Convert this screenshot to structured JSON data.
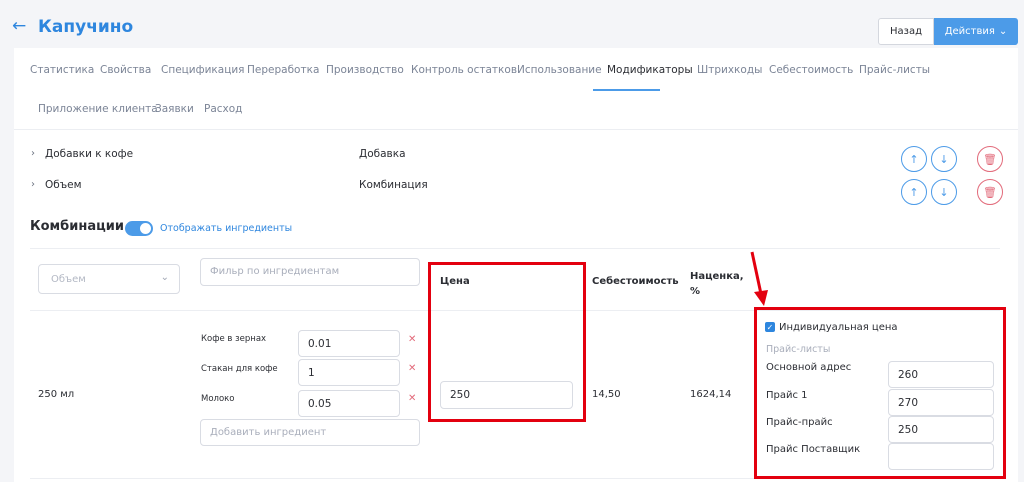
{
  "header": {
    "title": "Капучино",
    "back_button": "Назад",
    "actions_button": "Действия"
  },
  "tabs": [
    "Статистика",
    "Свойства",
    "Спецификация",
    "Переработка",
    "Производство",
    "Контроль остатков",
    "Использование",
    "Модификаторы",
    "Штрихкоды",
    "Себестоимость",
    "Прайс-листы",
    "Приложение клиента",
    "Заявки",
    "Расход"
  ],
  "active_tab": "Модификаторы",
  "modifiers": [
    {
      "name": "Добавки к кофе",
      "type": "Добавка"
    },
    {
      "name": "Объем",
      "type": "Комбинация"
    }
  ],
  "combinations": {
    "title": "Комбинации",
    "toggle_label": "Отображать ингредиенты",
    "toggle_on": true,
    "volume_select_placeholder": "Объем",
    "ingredient_filter_placeholder": "Фильр по ингредиентам",
    "columns": {
      "price": "Цена",
      "cost": "Себестоимость",
      "markup": "Наценка, %"
    },
    "row": {
      "volume": "250 мл",
      "ingredients": [
        {
          "name": "Кофе в зернах",
          "qty": "0.01"
        },
        {
          "name": "Стакан для кофе",
          "qty": "1"
        },
        {
          "name": "Молоко",
          "qty": "0.05"
        }
      ],
      "add_ingredient_placeholder": "Добавить ингредиент",
      "price": "250",
      "cost": "14,50",
      "markup": "1624,14",
      "individual_price_label": "Индивидуальная цена",
      "individual_price_checked": true,
      "price_lists_header": "Прайс-листы",
      "price_lists": [
        {
          "name": "Основной адрес",
          "value": "260"
        },
        {
          "name": "Прайс 1",
          "value": "270"
        },
        {
          "name": "Прайс-прайс",
          "value": "250"
        },
        {
          "name": "Прайс Поставщик",
          "value": ""
        }
      ]
    }
  },
  "colors": {
    "accent": "#4c9be8",
    "annotation_red": "#e3000f",
    "danger": "#e26a7a"
  }
}
